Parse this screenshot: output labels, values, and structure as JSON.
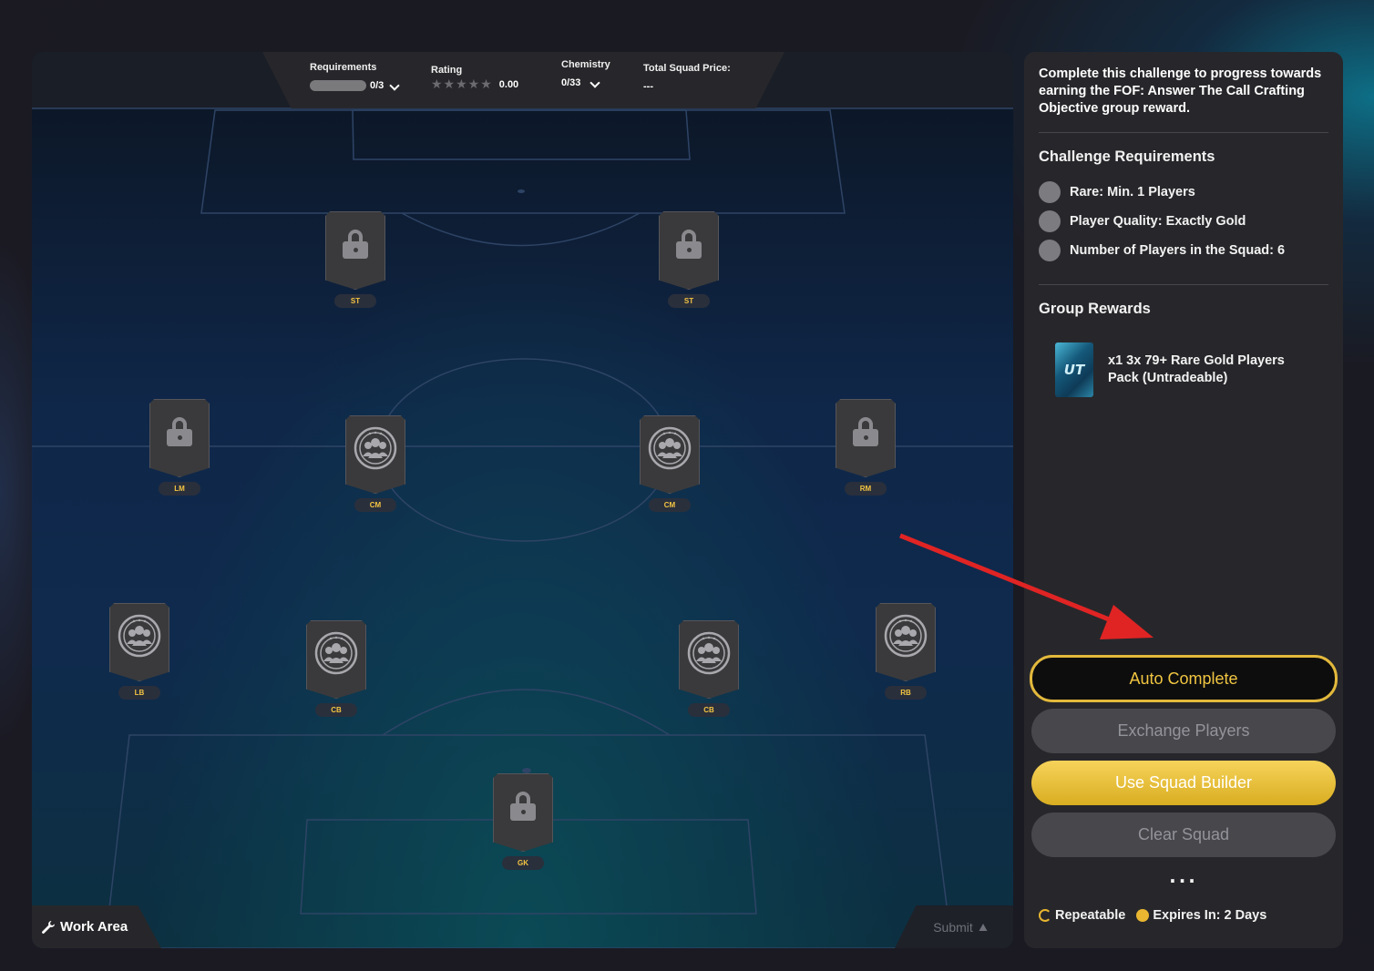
{
  "stats": {
    "requirements_label": "Requirements",
    "requirements_value": "0/3",
    "rating_label": "Rating",
    "rating_stars": "★★★★★",
    "rating_value": "0.00",
    "chemistry_label": "Chemistry",
    "chemistry_value": "0/33",
    "price_label": "Total Squad Price:",
    "price_value": "---"
  },
  "slots": {
    "st_left": {
      "pos": "ST",
      "state": "locked"
    },
    "st_right": {
      "pos": "ST",
      "state": "locked"
    },
    "lm": {
      "pos": "LM",
      "state": "locked"
    },
    "cm_left": {
      "pos": "CM",
      "state": "empty"
    },
    "cm_right": {
      "pos": "CM",
      "state": "empty"
    },
    "rm": {
      "pos": "RM",
      "state": "locked"
    },
    "lb": {
      "pos": "LB",
      "state": "empty"
    },
    "cb_left": {
      "pos": "CB",
      "state": "empty"
    },
    "cb_right": {
      "pos": "CB",
      "state": "empty"
    },
    "rb": {
      "pos": "RB",
      "state": "empty"
    },
    "gk": {
      "pos": "GK",
      "state": "locked"
    }
  },
  "work_area_label": "Work Area",
  "submit_label": "Submit",
  "panel": {
    "description": "Complete this challenge to progress towards earning the FOF: Answer The Call Crafting Objective group reward.",
    "requirements_heading": "Challenge Requirements",
    "requirements": [
      "Rare: Min. 1 Players",
      "Player Quality: Exactly Gold",
      "Number of Players in the Squad: 6"
    ],
    "rewards_heading": "Group Rewards",
    "reward_pack_icon_text": "UT",
    "reward_text": "x1 3x 79+ Rare Gold Players Pack (Untradeable)",
    "buttons": {
      "auto_complete": "Auto Complete",
      "exchange": "Exchange Players",
      "squad_builder": "Use Squad Builder",
      "clear": "Clear Squad"
    },
    "more": "...",
    "repeatable": "Repeatable",
    "expires": "Expires In: 2 Days"
  },
  "colors": {
    "accent_gold": "#f0c541",
    "position_badge": "#f4c542",
    "annotation_arrow": "#e02424"
  },
  "icons": [
    "lock-icon",
    "players-icon",
    "wrench-icon",
    "triangle-up-icon",
    "repeat-icon",
    "clock-icon",
    "chevron-down-icon",
    "ut-pack-icon"
  ]
}
